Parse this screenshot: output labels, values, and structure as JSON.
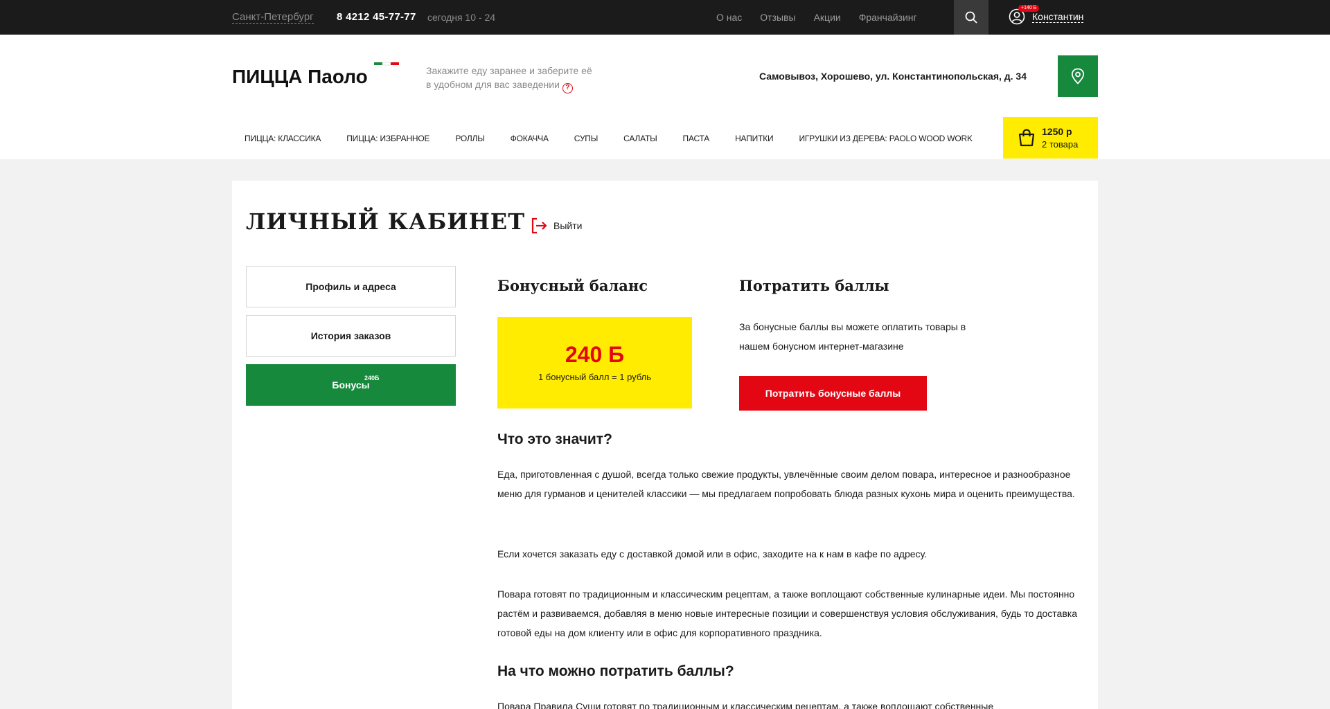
{
  "topbar": {
    "city": "Санкт-Петербург",
    "phone": "8 4212 45-77-77",
    "hours": "сегодня 10 - 24",
    "links": [
      "О нас",
      "Отзывы",
      "Акции",
      "Франчайзинг"
    ],
    "user_badge": "+140 Б",
    "user_name": "Константин"
  },
  "header": {
    "logo_text": "ПИЦЦА Паоло",
    "tagline_line1": "Закажите еду заранее и заберите её",
    "tagline_line2": "в удобном для вас заведении",
    "help_glyph": "?",
    "pickup": "Самовывоз, Хорошево, ул. Константинопольская, д. 34",
    "categories": [
      "Пицца: классика",
      "Пицца: избранное",
      "Роллы",
      "Фокачча",
      "Супы",
      "Салаты",
      "Паста",
      "Напитки",
      "Игрушки из дерева: Paolo Wood Work"
    ],
    "cart_sum": "1250 р",
    "cart_count": "2 товара"
  },
  "page": {
    "title": "ЛИЧНЫЙ КАБИНЕТ",
    "logout": "Выйти",
    "menu": [
      {
        "label": "Профиль и адреса"
      },
      {
        "label": "История заказов"
      },
      {
        "label": "Бонусы",
        "badge": "240Б"
      }
    ],
    "bonus_heading": "Бонусный баланс",
    "bonus_amount": "240 Б",
    "bonus_rate": "1 бонусный балл = 1 рубль",
    "spend_heading": "Потратить баллы",
    "spend_text": "За бонусные баллы вы можете оплатить товары в нашем бонусном интернет-магазине",
    "spend_button": "Потратить бонусные баллы",
    "q1": "Что это значит?",
    "p1": "Еда, приготовленная с душой, всегда только свежие продукты, увлечённые своим делом повара, интересное и разнообразное меню для гурманов и ценителей классики — мы предлагаем попробовать блюда разных кухонь мира и оценить преимущества.",
    "p2": "Если хочется заказать еду с доставкой домой или в офис, заходите на к нам в кафе по адресу.",
    "p3": "Повара готовят по традиционным и классическим рецептам, а также воплощают собственные кулинарные идеи. Мы постоянно растём и развиваемся, добавляя в меню новые интересные позиции и совершенствуя условия обслуживания, будь то доставка готовой еды на дом клиенту или в офис для корпоративного праздника.",
    "q2": "На что можно потратить баллы?",
    "p4": "Повара Правила Суши готовят по традиционным и классическим рецептам, а также воплощают собственные"
  },
  "colors": {
    "green": "#17893d",
    "red": "#e30613",
    "yellow": "#ffec00",
    "dark": "#1b1b1b"
  },
  "icons": {
    "search": "search-icon",
    "user": "user-icon",
    "location": "location-pin-icon",
    "cart": "shopping-bag-icon",
    "logout": "logout-icon",
    "help": "help-icon"
  }
}
